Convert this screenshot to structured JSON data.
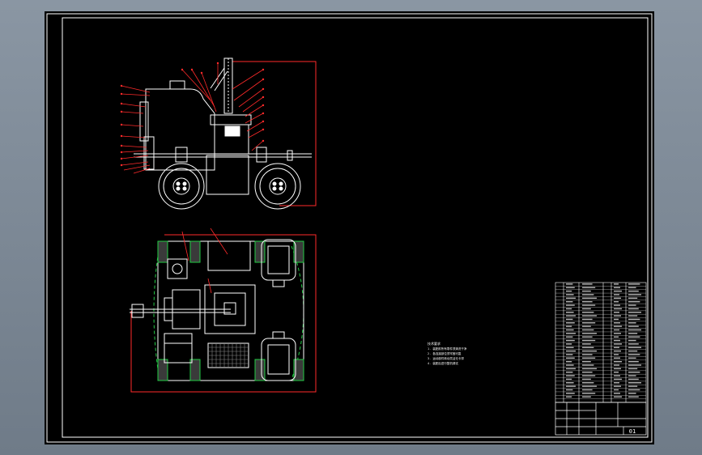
{
  "drawing": {
    "sheet_number": "01",
    "notes_title": "技术要求",
    "notes": [
      "1. 装配前所有零件须清洗干净",
      "2. 各连接部位须牢固可靠",
      "3. 运动部件转动灵活无卡滞",
      "4. 装配后进行整机调试"
    ],
    "colors": {
      "outline": "#ffffff",
      "leader": "#ff2a2a",
      "centerline": "#22cc44",
      "sheet": "#000000"
    }
  }
}
